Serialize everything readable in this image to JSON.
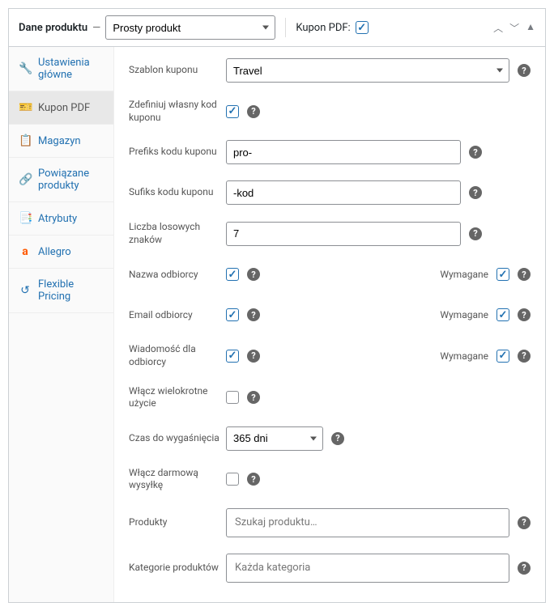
{
  "header": {
    "title": "Dane produktu",
    "dash": "—",
    "productType": "Prosty produkt",
    "pdfLabel": "Kupon PDF:"
  },
  "tabs": {
    "settings": "Ustawienia główne",
    "pdf": "Kupon PDF",
    "inventory": "Magazyn",
    "linked": "Powiązane produkty",
    "attributes": "Atrybuty",
    "allegro": "Allegro",
    "flexible": "Flexible Pricing"
  },
  "fields": {
    "template": {
      "label": "Szablon kuponu",
      "value": "Travel"
    },
    "define": {
      "label": "Zdefiniuj własny kod kuponu"
    },
    "prefix": {
      "label": "Prefiks kodu kuponu",
      "value": "pro-"
    },
    "suffix": {
      "label": "Sufiks kodu kuponu",
      "value": "-kod"
    },
    "random": {
      "label": "Liczba losowych znaków",
      "value": "7"
    },
    "recipientName": {
      "label": "Nazwa odbiorcy",
      "required": "Wymagane"
    },
    "recipientEmail": {
      "label": "Email odbiorcy",
      "required": "Wymagane"
    },
    "recipientMsg": {
      "label": "Wiadomość dla odbiorcy",
      "required": "Wymagane"
    },
    "multi": {
      "label": "Włącz wielokrotne użycie"
    },
    "expiry": {
      "label": "Czas do wygaśnięcia",
      "value": "365 dni"
    },
    "freeShip": {
      "label": "Włącz darmową wysyłkę"
    },
    "products": {
      "label": "Produkty",
      "placeholder": "Szukaj produktu…"
    },
    "categories": {
      "label": "Kategorie produktów",
      "placeholder": "Każda kategoria"
    }
  }
}
